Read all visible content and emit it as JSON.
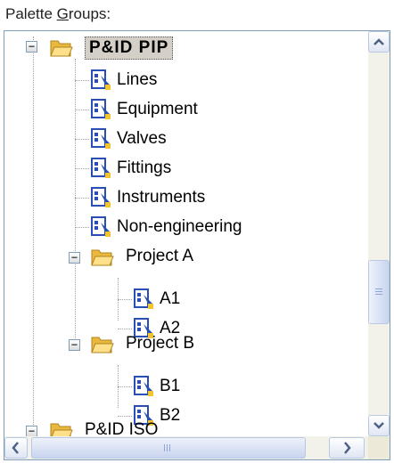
{
  "label": {
    "prefix": "Palette ",
    "accel": "G",
    "rest": "roups:"
  },
  "tree": {
    "root1": "P&ID PIP",
    "root1_children": [
      "Lines",
      "Equipment",
      "Valves",
      "Fittings",
      "Instruments",
      "Non-engineering"
    ],
    "projectA": "Project A",
    "projectA_children": [
      "A1",
      "A2"
    ],
    "projectB": "Project B",
    "projectB_children": [
      "B1",
      "B2"
    ],
    "root2": "P&ID ISO"
  },
  "icons": {
    "expander": "minus-box-icon",
    "folder": "folder-open-icon",
    "palette": "tool-palette-icon",
    "scroll_up": "arrow-up-icon",
    "scroll_down": "arrow-down-icon",
    "scroll_left": "arrow-left-icon",
    "scroll_right": "arrow-right-icon"
  },
  "colors": {
    "selection": "#d4d0c8",
    "folder": "#f5c84c",
    "palette_icon": "#2a4fb4",
    "border": "#7f9db9"
  }
}
